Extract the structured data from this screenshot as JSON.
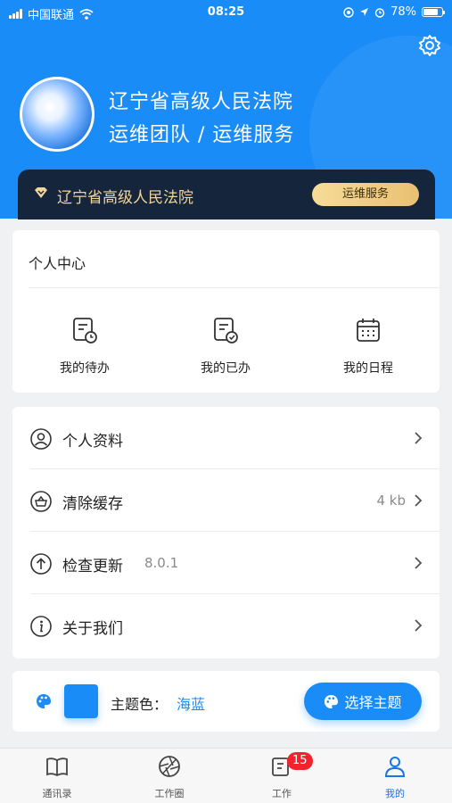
{
  "status_bar": {
    "carrier": "中国联通",
    "time": "08:25",
    "battery": "78%",
    "battery_level": 0.78
  },
  "profile": {
    "name": "辽宁省高级人民法院",
    "team": "运维团队 / 运维服务"
  },
  "org_bar": {
    "name": "辽宁省高级人民法院",
    "badge": "运维服务"
  },
  "personal_center": {
    "title": "个人中心",
    "items": [
      {
        "label": "我的待办",
        "icon": "todo-icon"
      },
      {
        "label": "我的已办",
        "icon": "done-icon"
      },
      {
        "label": "我的日程",
        "icon": "calendar-icon"
      }
    ]
  },
  "menu": {
    "items": [
      {
        "label": "个人资料",
        "icon": "user-icon",
        "value": "",
        "right": ""
      },
      {
        "label": "清除缓存",
        "icon": "basket-icon",
        "value": "",
        "right": "4 kb"
      },
      {
        "label": "检查更新",
        "icon": "upload-icon",
        "value": "8.0.1",
        "right": ""
      },
      {
        "label": "关于我们",
        "icon": "info-icon",
        "value": "",
        "right": ""
      }
    ]
  },
  "theme": {
    "label": "主题色：",
    "value": "海蓝",
    "button": "选择主题",
    "color": "#1a8cf7"
  },
  "tabbar": {
    "items": [
      {
        "label": "通讯录",
        "icon": "book-icon"
      },
      {
        "label": "工作圈",
        "icon": "aperture-icon"
      },
      {
        "label": "工作",
        "icon": "work-icon",
        "badge": "15"
      },
      {
        "label": "我的",
        "icon": "person-icon"
      }
    ]
  }
}
